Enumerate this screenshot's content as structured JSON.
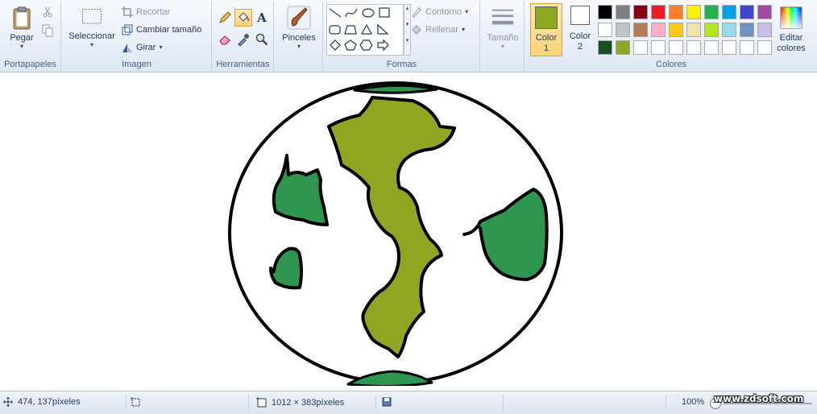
{
  "ribbon": {
    "portapapeles": {
      "label": "Portapapeles",
      "paste": "Pegar"
    },
    "imagen": {
      "label": "Imagen",
      "select": "Seleccionar",
      "crop": "Recortar",
      "resize": "Cambiar tamaño",
      "rotate": "Girar"
    },
    "herramientas": {
      "label": "Herramientas"
    },
    "pinceles": {
      "label": "Pinceles"
    },
    "formas": {
      "label": "Formas",
      "outline": "Contorno",
      "fill": "Rellenar"
    },
    "tamano": {
      "label": "Tamaño"
    },
    "colores": {
      "label": "Colores",
      "color1_line1": "Color",
      "color1_line2": "1",
      "color2_line1": "Color",
      "color2_line2": "2",
      "edit_line1": "Editar",
      "edit_line2": "colores",
      "color1_value": "#8fa623",
      "color2_value": "#ffffff"
    }
  },
  "palette": {
    "row1": [
      "#000000",
      "#7f7f7f",
      "#880015",
      "#ed1c24",
      "#ff7f27",
      "#fff200",
      "#22b14c",
      "#00a2e8",
      "#3f48cc",
      "#a349a4"
    ],
    "row2": [
      "#ffffff",
      "#c3c3c3",
      "#b97a57",
      "#ffaec9",
      "#ffc90e",
      "#efe4b0",
      "#b5e61d",
      "#99d9ea",
      "#7092be",
      "#c8bfe7"
    ],
    "row3": [
      "#1a4d1f",
      "#8fa623"
    ]
  },
  "status": {
    "cursor_pos": "474, 137píxeles",
    "image_size": "1012 × 383píxeles",
    "zoom": "100%",
    "watermark": "www.zdsoft.com"
  },
  "drawing": {
    "ocean_fill": "#ffffff",
    "land_light": "#8fa623",
    "land_dark": "#2f9650",
    "outline": "#000000"
  }
}
